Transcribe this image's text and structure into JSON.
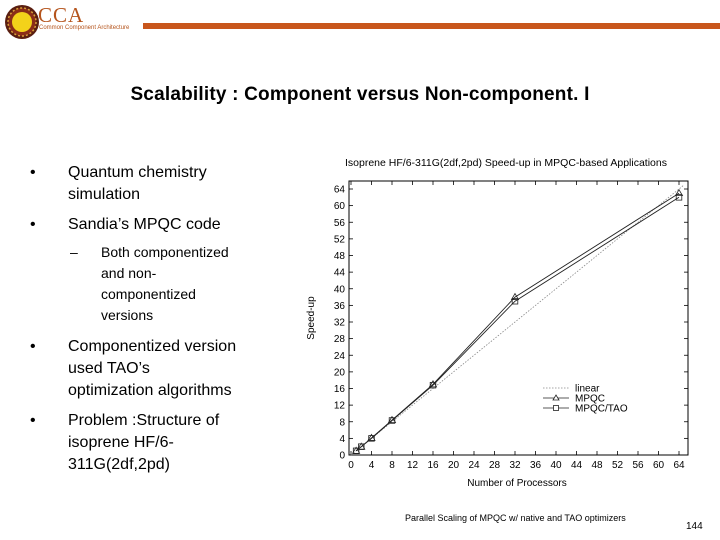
{
  "header": {
    "logo_title": "CCA",
    "logo_subtitle": "Common Component Architecture",
    "accent_color": "#c8561c"
  },
  "slide": {
    "title": "Scalability : Component versus Non-component. I",
    "bullets": [
      {
        "text_lines": [
          "Quantum chemistry",
          "simulation"
        ]
      },
      {
        "text_lines": [
          "Sandia’s MPQC code"
        ],
        "sub": [
          {
            "text_lines": [
              "Both componentized",
              "and non-",
              "componentized",
              "versions"
            ]
          }
        ]
      },
      {
        "text_lines": [
          "Componentized version",
          "used TAO’s",
          "optimization algorithms"
        ]
      },
      {
        "text_lines": [
          "Problem :Structure of",
          "isoprene HF/6-",
          "311G(2df,2pd)"
        ]
      }
    ],
    "bullet_glyph": "•",
    "sub_bullet_glyph": "–",
    "caption": "Parallel Scaling of MPQC w/ native and TAO optimizers",
    "page_number": "144"
  },
  "chart_data": {
    "type": "line",
    "title": "Isoprene HF/6-311G(2df,2pd) Speed-up in MPQC-based Applications",
    "xlabel": "Number of Processors",
    "ylabel": "Speed-up",
    "xlim": [
      0,
      66
    ],
    "ylim": [
      0,
      66
    ],
    "xticks": [
      0,
      4,
      8,
      12,
      16,
      20,
      24,
      28,
      32,
      36,
      40,
      44,
      48,
      52,
      56,
      60,
      64
    ],
    "yticks": [
      0,
      4,
      8,
      12,
      16,
      20,
      24,
      28,
      32,
      36,
      40,
      44,
      48,
      52,
      56,
      60,
      64
    ],
    "grid": false,
    "legend_position": "bottom-right",
    "series": [
      {
        "name": "linear",
        "style": "dotted",
        "marker": "none",
        "x": [
          0,
          66
        ],
        "y": [
          0,
          66
        ]
      },
      {
        "name": "MPQC",
        "style": "solid",
        "marker": "triangle",
        "x": [
          1,
          2,
          4,
          8,
          16,
          32,
          64
        ],
        "y": [
          1,
          2,
          4.1,
          8.4,
          17,
          38,
          63
        ]
      },
      {
        "name": "MPQC/TAO",
        "style": "solid",
        "marker": "square",
        "x": [
          1,
          2,
          4,
          8,
          16,
          32,
          64
        ],
        "y": [
          1,
          2,
          4,
          8.3,
          16.8,
          37,
          62
        ]
      }
    ]
  }
}
